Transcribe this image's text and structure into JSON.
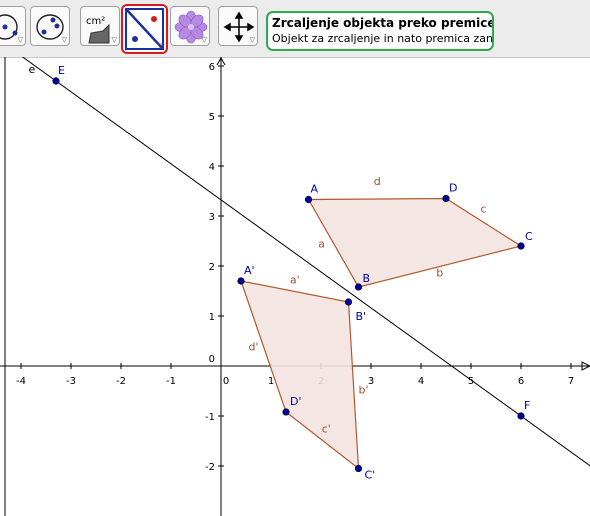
{
  "toolbar": {
    "tools": [
      {
        "name": "circle-tool"
      },
      {
        "name": "conic-tool"
      },
      {
        "name": "area-tool",
        "label": "cm²"
      },
      {
        "name": "reflect-about-line-tool",
        "selected": true
      },
      {
        "name": "flower-tool"
      },
      {
        "name": "move-graphics-view-tool"
      }
    ],
    "help": {
      "title": "Zrcaljenje objekta preko premice",
      "description": "Objekt za zrcaljenje in nato premica zanj"
    },
    "colors": {
      "selected_outline": "#d71920",
      "help_outline": "#2fa84f"
    }
  },
  "graphics": {
    "x_ticks": [
      "-4",
      "-3",
      "-2",
      "-1",
      "0",
      "1",
      "2",
      "3",
      "4",
      "5",
      "6",
      "7"
    ],
    "y_ticks": [
      "-2",
      "-1",
      "0",
      "1",
      "2",
      "3",
      "4",
      "5",
      "6"
    ],
    "line": {
      "name": "e",
      "through": [
        [
          -3.3,
          5.7
        ],
        [
          6,
          -1
        ]
      ]
    },
    "points": [
      {
        "name": "E",
        "x": -3.3,
        "y": 5.7
      },
      {
        "name": "F",
        "x": 6,
        "y": -1
      },
      {
        "name": "A",
        "x": 1.75,
        "y": 3.33
      },
      {
        "name": "B",
        "x": 2.75,
        "y": 1.58
      },
      {
        "name": "C",
        "x": 6,
        "y": 2.4
      },
      {
        "name": "D",
        "x": 4.5,
        "y": 3.35
      },
      {
        "name": "A'",
        "x": 0.4,
        "y": 1.7
      },
      {
        "name": "B'",
        "x": 2.55,
        "y": 1.28
      },
      {
        "name": "C'",
        "x": 2.75,
        "y": -2.05
      },
      {
        "name": "D'",
        "x": 1.3,
        "y": -0.92
      }
    ],
    "polygons": [
      {
        "vertices": [
          "A",
          "B",
          "C",
          "D"
        ],
        "sides": [
          "a",
          "b",
          "c",
          "d"
        ]
      },
      {
        "vertices": [
          "A'",
          "B'",
          "C'",
          "D'"
        ],
        "sides": [
          "a'",
          "b'",
          "c'",
          "d'"
        ]
      }
    ],
    "colors": {
      "point": "#0000a0",
      "polygon_edge": "#b05a30",
      "polygon_fill": "#f3e4e0",
      "line": "#000000"
    }
  }
}
